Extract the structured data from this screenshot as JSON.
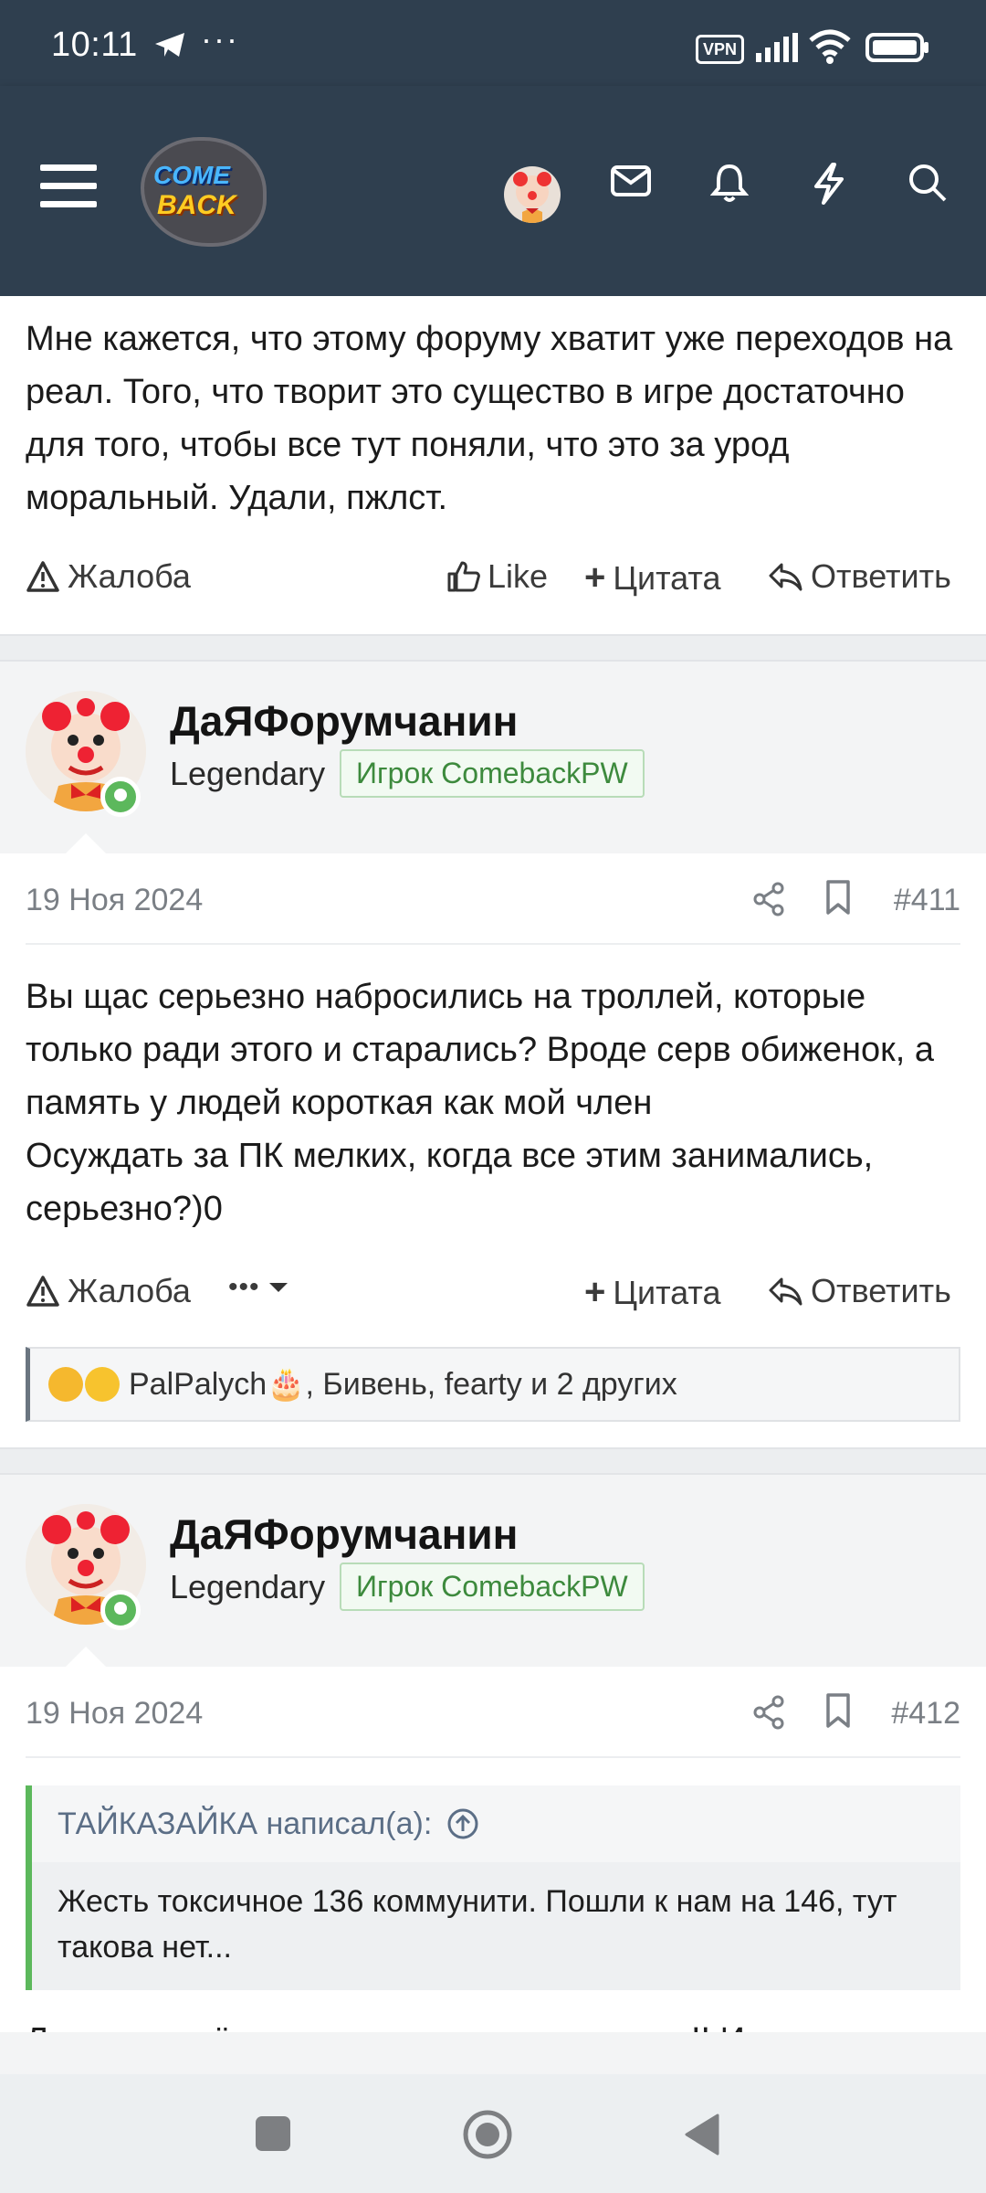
{
  "status_bar": {
    "time": "10:11",
    "dots": "···",
    "vpn": "VPN"
  },
  "header": {
    "logo_top": "COME",
    "logo_bottom": "BACK"
  },
  "post_top": {
    "text": "Мне кажется, что этому форуму хватит уже переходов на реал. Того, что творит это существо в игре достаточно для того, чтобы все тут поняли, что это за урод моральный. Удали, пжлст.",
    "report": "Жалоба",
    "like": "Like",
    "quote": "Цитата",
    "reply": "Ответить"
  },
  "post_411": {
    "username": "ДаЯФорумчанин",
    "rank": "Legendary",
    "badge": "Игрок ComebackPW",
    "date": "19 Ноя 2024",
    "number": "#411",
    "text_line1": "Вы щас серьезно набросились на троллей, которые только ради этого и старались? Вроде серв обиженок, а память у людей короткая как мой член",
    "text_line2": "Осуждать за ПК мелких, когда все этим занимались, серьезно?)0",
    "report": "Жалоба",
    "more": "•••",
    "quote": "Цитата",
    "reply": "Ответить",
    "reactions_text": "PalPalych🎂, Бивень, fearty и 2 других"
  },
  "post_412": {
    "username": "ДаЯФорумчанин",
    "rank": "Legendary",
    "badge": "Игрок ComebackPW",
    "date": "19 Ноя 2024",
    "number": "#412",
    "quote_author": "ТАЙКАЗАЙКА написал(а):",
    "quote_text": "Жесть токсичное 136 коммунити. Пошли к нам на 146, тут такова нет...",
    "text_partial": "Ложь враньё и провокация, ето везде так!! И"
  },
  "colors": {
    "header_bg": "#2f3f4f",
    "online": "#5cb85c",
    "quote_border": "#5cb85c",
    "badge_text": "#3d8a3d"
  }
}
